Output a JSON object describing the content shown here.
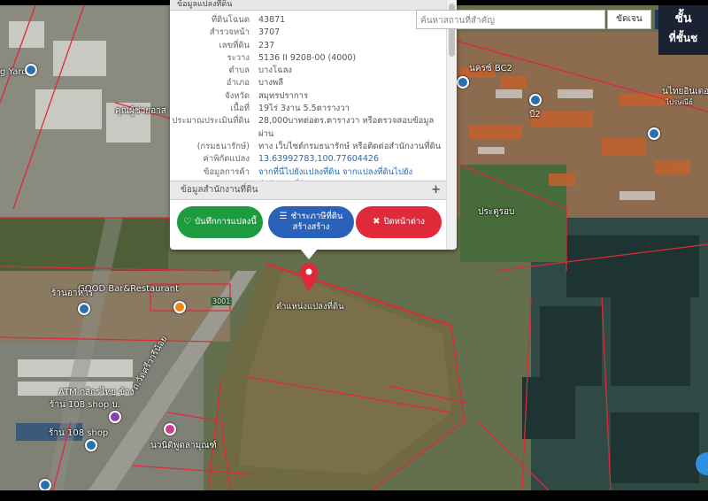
{
  "popup": {
    "header_partial": "ข้อมูลแปลงที่ดิน",
    "rows": [
      {
        "key": "ที่ดินโฉนด",
        "value": "43871"
      },
      {
        "key": "สำรวจหน้า",
        "value": "3707"
      },
      {
        "key": "เลขที่ดิน",
        "value": "237"
      },
      {
        "key": "ระวาง",
        "value": "5136 II 9208-00 (4000)"
      },
      {
        "key": "ตำบล",
        "value": "บางโฉลง"
      },
      {
        "key": "อำเภอ",
        "value": "บางพลี"
      },
      {
        "key": "จังหวัด",
        "value": "สมุทรปราการ"
      },
      {
        "key": "เนื้อที่",
        "value": "19ไร่ 3งาน 5.5ตารางวา"
      },
      {
        "key": "ประมาณประเมินที่ดิน",
        "value": "28,000บาทต่อตร.ตารางวา หรือตรวจสอบข้อมูลผ่าน"
      },
      {
        "key": "(กรมธนารักษ์)",
        "value": "ทาง เว็บไซต์กรมธนารักษ์ หรือติดต่อสำนักงานที่ดิน"
      },
      {
        "key": "ค่าพิกัดแปลง",
        "value": "13.63992783,100.77604426"
      },
      {
        "key": "ข้อมูลการค้า",
        "value": "จากที่นี่ไปยังแปลงที่ดิน จากแปลงที่ดินไปยัง"
      },
      {
        "key": "",
        "value": "สำนักงานที่ดิน"
      }
    ],
    "office_section": "ข้อมูลสำนักงานที่ดิน",
    "buttons": {
      "save": "บันทึกการแปลงนี้",
      "pay_line1": "ชำระภาษีที่ดิน",
      "pay_line2": "สร้างสร้าง",
      "close": "ปิดหน้าต่าง"
    }
  },
  "search": {
    "placeholder": "ค้นหาสถานที่สำคัญ",
    "button": "ขัดเจน"
  },
  "layer": {
    "line1": "ชั้น",
    "line2": "ที่ชั้นช"
  },
  "marker_label": "ตำแหน่งแปลงที่ดิน",
  "map_labels": {
    "yard": "g Yard",
    "bc2": "นครซ์ BC2",
    "b2": "บี2",
    "thai_inter": "นไทยอินเตอร์",
    "thai_inter_sub": "ไปรษณีย์",
    "gate": "ประตูรอบ",
    "good_bar": "GOOD Bar&Restaurant",
    "rest_left": "ร้านอาหาร",
    "atm": "ATM กสิกรไทย ข้าง",
    "shop108a": "ร้าน 108 shop บ.",
    "shop108b": "ร้าน 108 shop",
    "road": "ถ.วัดศรีวารีน้อย",
    "route": "3001",
    "pharmacy": "นวนิติพูดลามุณฑ์",
    "area_top": "คุณผู้ช่วยอาส"
  },
  "colors": {
    "parcel_line": "#e0283a",
    "save_btn": "#1e9b3e",
    "pay_btn": "#2a62b9",
    "close_btn": "#e02a3a",
    "marker": "#e0283a"
  }
}
